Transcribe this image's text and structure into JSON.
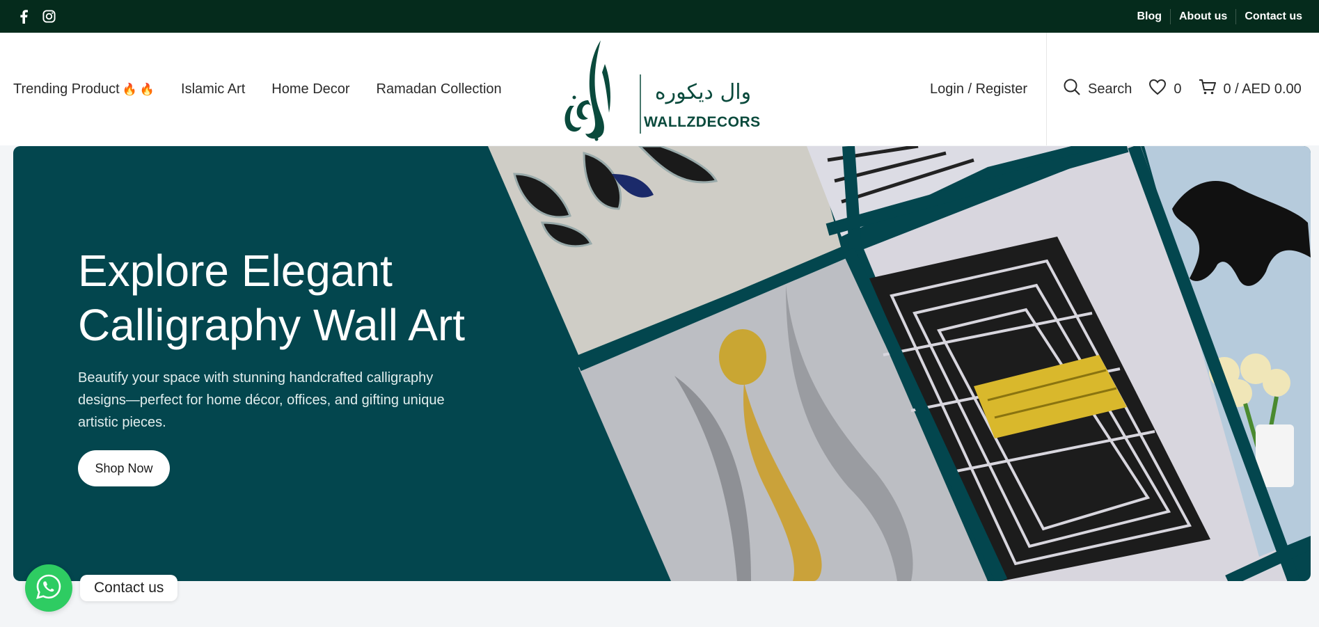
{
  "topbar": {
    "social": [
      "facebook-icon",
      "instagram-icon"
    ],
    "links": [
      "Blog",
      "About us",
      "Contact us"
    ],
    "bg_color": "#052b1c"
  },
  "nav": {
    "items": [
      "Trending Product",
      "Islamic Art",
      "Home Decor",
      "Ramadan Collection"
    ]
  },
  "logo": {
    "arabic": "وال ديكوره",
    "text": "WALLZDECORS",
    "brand_color": "#0a4a3c"
  },
  "account": {
    "label": "Login / Register"
  },
  "tools": {
    "search_label": "Search",
    "wishlist_count": "0",
    "cart_label": "0 / AED 0.00"
  },
  "hero": {
    "title": "Explore Elegant Calligraphy Wall Art",
    "subtitle": "Beautify your space with stunning handcrafted calligraphy designs—perfect for home décor, offices, and gifting unique artistic pieces.",
    "button": "Shop Now",
    "bg_color": "#03464e"
  },
  "whatsapp": {
    "label": "Contact us",
    "color": "#2ecc62"
  }
}
